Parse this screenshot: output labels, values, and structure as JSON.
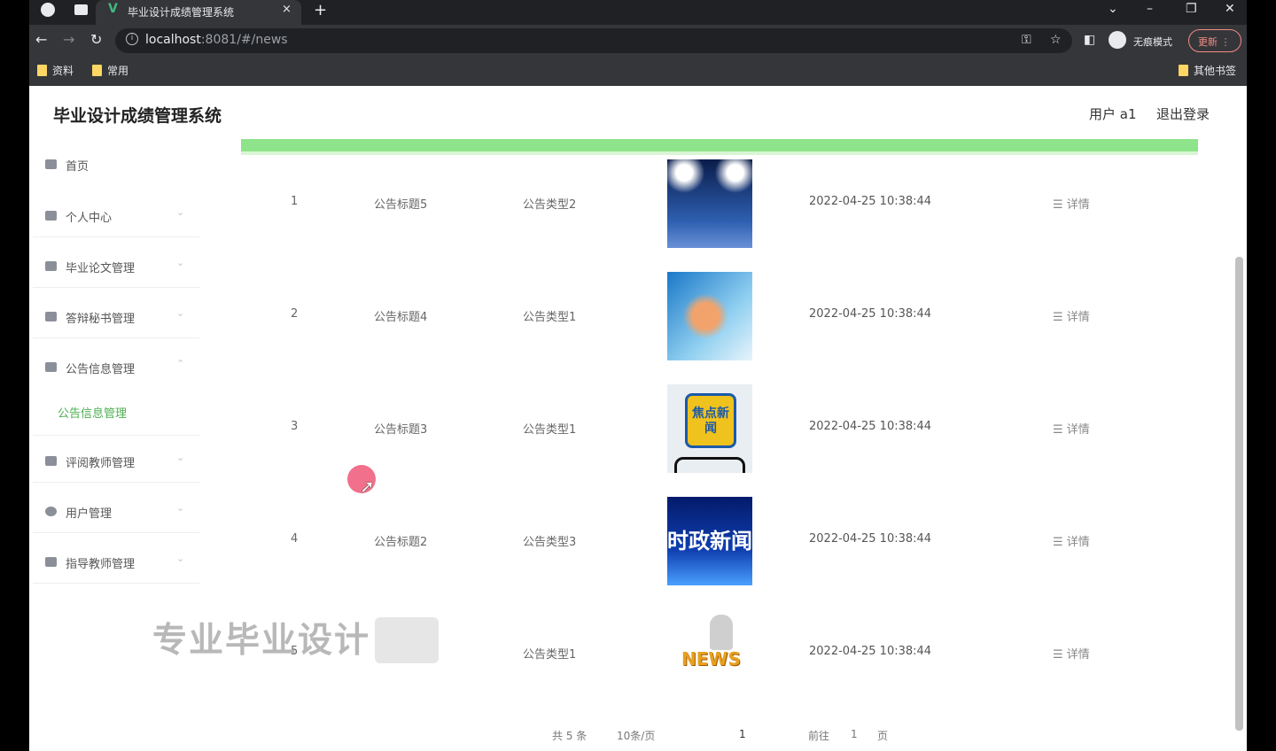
{
  "browser": {
    "tab_title": "毕业设计成绩管理系统",
    "tab_close": "×",
    "new_tab": "+",
    "url_host": "localhost",
    "url_path": ":8081/#/news",
    "incognito_label": "无痕模式",
    "update_label": "更新",
    "bookmarks": [
      "资料",
      "常用"
    ],
    "other_bookmarks": "其他书签"
  },
  "header": {
    "app_title": "毕业设计成绩管理系统",
    "user_label": "用户 a1",
    "logout_label": "退出登录"
  },
  "sidebar": {
    "items": [
      {
        "label": "首页",
        "icon": "home-icon"
      },
      {
        "label": "个人中心",
        "icon": "user-icon"
      },
      {
        "label": "毕业论文管理",
        "icon": "document-icon"
      },
      {
        "label": "答辩秘书管理",
        "icon": "list-icon"
      },
      {
        "label": "公告信息管理",
        "icon": "grid-icon"
      },
      {
        "label": "评阅教师管理",
        "icon": "card-icon"
      },
      {
        "label": "用户管理",
        "icon": "clock-icon"
      },
      {
        "label": "指导教师管理",
        "icon": "table-icon"
      }
    ],
    "active_sub": "公告信息管理"
  },
  "table": {
    "rows": [
      {
        "index": "1",
        "title": "公告标题5",
        "type": "公告类型2",
        "time": "2022-04-25 10:38:44",
        "detail": "详情"
      },
      {
        "index": "2",
        "title": "公告标题4",
        "type": "公告类型1",
        "time": "2022-04-25 10:38:44",
        "detail": "详情"
      },
      {
        "index": "3",
        "title": "公告标题3",
        "type": "公告类型1",
        "time": "2022-04-25 10:38:44",
        "detail": "详情"
      },
      {
        "index": "4",
        "title": "公告标题2",
        "type": "公告类型3",
        "time": "2022-04-25 10:38:44",
        "detail": "详情"
      },
      {
        "index": "5",
        "title": "",
        "type": "公告类型1",
        "time": "2022-04-25 10:38:44",
        "detail": "详情"
      }
    ],
    "thumb_text": {
      "badge": "焦点新闻",
      "banner": "时政新闻",
      "news": "NEWS"
    }
  },
  "pagination": {
    "total": "共 5 条",
    "page_size": "10条/页",
    "current_page": "1",
    "goto_label": "前往",
    "goto_value": "1",
    "page_unit": "页"
  },
  "overlay": {
    "watermark": "专业毕业设计"
  }
}
